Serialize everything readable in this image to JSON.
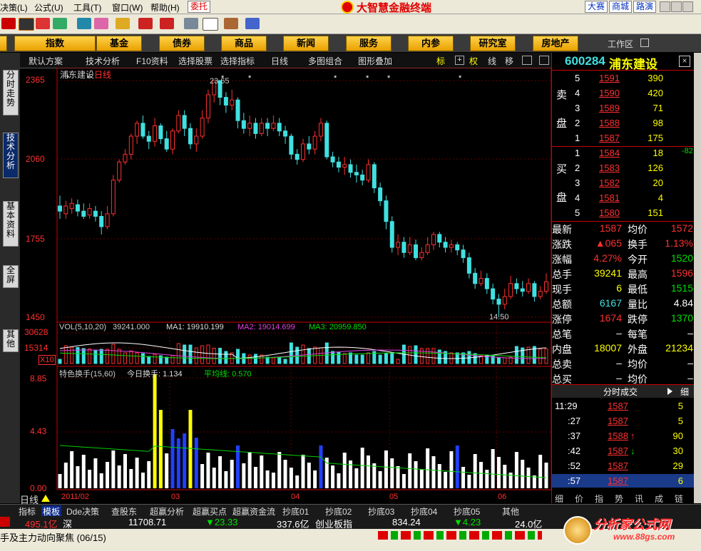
{
  "menu": {
    "items": [
      "决策(L)",
      "公式(U)",
      "工具(T)",
      "窗口(W)",
      "帮助(H)"
    ],
    "trade_tag": "委托",
    "brand": "大智慧金融终端",
    "right_tags": [
      "大赛",
      "商城",
      "路演"
    ]
  },
  "nav": {
    "buttons": [
      "指数",
      "基金",
      "债券",
      "商品",
      "新闻",
      "服务",
      "内参",
      "研究室",
      "房地产"
    ],
    "workspace": "工作区"
  },
  "left_tabs": [
    "分时走势",
    "技术分析",
    "基本资料",
    "全屏",
    "其他"
  ],
  "chart_toolbar": {
    "items": [
      "默认方案",
      "技术分析",
      "F10资料",
      "选择股票",
      "选择指标",
      "日线",
      "多图组合",
      "图形叠加"
    ],
    "right_items": [
      "标",
      "权",
      "线",
      "移"
    ]
  },
  "chart": {
    "stock_label": "浦东建设",
    "period_label": "日线",
    "y_ticks": [
      "2365",
      "2060",
      "1755",
      "1450"
    ],
    "high_mark": "23.65",
    "low_mark": "14.50",
    "vol_header": "VOL(5,10,20)",
    "vol_value": "39241.000",
    "ma1": "MA1: 19910.199",
    "ma2": "MA2: 19014.699",
    "ma3": "MA3: 20959.850",
    "vol_ticks": [
      "30628",
      "15314",
      "X10"
    ],
    "turn_header": "特色换手(15,60)",
    "turn_today": "今日换手: 1.134",
    "turn_avg": "平均线: 0.570",
    "turn_ticks": [
      "8.85",
      "4.43",
      "0.00"
    ],
    "x_labels": [
      "2011/02",
      "03",
      "04",
      "05",
      "06"
    ],
    "bottom_label": "日线"
  },
  "chart_data": {
    "type": "candlestick",
    "title": "浦东建设 日线",
    "ylim": [
      1450,
      2365
    ],
    "x_months": [
      "2011/02",
      "03",
      "04",
      "05",
      "06"
    ],
    "candles": [
      [
        1880,
        1860,
        1920,
        1830
      ],
      [
        1850,
        1880,
        1900,
        1830
      ],
      [
        1870,
        1890,
        1910,
        1850
      ],
      [
        1885,
        1860,
        1905,
        1840
      ],
      [
        1860,
        1840,
        1890,
        1830
      ],
      [
        1845,
        1870,
        1890,
        1830
      ],
      [
        1860,
        1840,
        1880,
        1820
      ],
      [
        1840,
        1800,
        1860,
        1770
      ],
      [
        1800,
        1850,
        1880,
        1790
      ],
      [
        1850,
        1980,
        2000,
        1840
      ],
      [
        1980,
        2050,
        2060,
        1970
      ],
      [
        2050,
        2080,
        2100,
        2040
      ],
      [
        2080,
        2150,
        2160,
        2060
      ],
      [
        2150,
        2200,
        2210,
        2120
      ],
      [
        2200,
        2150,
        2230,
        2140
      ],
      [
        2150,
        2130,
        2170,
        2100
      ],
      [
        2130,
        2190,
        2220,
        2110
      ],
      [
        2190,
        2140,
        2200,
        2120
      ],
      [
        2140,
        2100,
        2170,
        2090
      ],
      [
        2100,
        2170,
        2180,
        2080
      ],
      [
        2170,
        2230,
        2250,
        2160
      ],
      [
        2230,
        2180,
        2250,
        2150
      ],
      [
        2180,
        2120,
        2200,
        2100
      ],
      [
        2120,
        2150,
        2180,
        2090
      ],
      [
        2150,
        2220,
        2250,
        2140
      ],
      [
        2220,
        2310,
        2330,
        2200
      ],
      [
        2310,
        2365,
        2365,
        2280
      ],
      [
        2365,
        2300,
        2365,
        2270
      ],
      [
        2300,
        2270,
        2320,
        2240
      ],
      [
        2270,
        2290,
        2330,
        2250
      ],
      [
        2290,
        2210,
        2300,
        2180
      ],
      [
        2210,
        2180,
        2240,
        2160
      ],
      [
        2180,
        2200,
        2230,
        2150
      ],
      [
        2200,
        2160,
        2220,
        2140
      ],
      [
        2160,
        2200,
        2220,
        2150
      ],
      [
        2200,
        2180,
        2220,
        2150
      ],
      [
        2180,
        2200,
        2230,
        2170
      ],
      [
        2200,
        2170,
        2220,
        2150
      ],
      [
        2170,
        2150,
        2190,
        2120
      ],
      [
        2150,
        2080,
        2160,
        2060
      ],
      [
        2080,
        2060,
        2100,
        2040
      ],
      [
        2060,
        2120,
        2140,
        2050
      ],
      [
        2120,
        2100,
        2150,
        2080
      ],
      [
        2100,
        2150,
        2170,
        2080
      ],
      [
        2150,
        2200,
        2220,
        2130
      ],
      [
        2200,
        2070,
        2210,
        2060
      ],
      [
        2070,
        2050,
        2090,
        2030
      ],
      [
        2050,
        2030,
        2070,
        2010
      ],
      [
        2030,
        2040,
        2070,
        2000
      ],
      [
        2040,
        2010,
        2060,
        1990
      ],
      [
        2010,
        2000,
        2040,
        1970
      ],
      [
        2000,
        1980,
        2020,
        1960
      ],
      [
        1980,
        2040,
        2060,
        1970
      ],
      [
        2040,
        1950,
        2050,
        1930
      ],
      [
        1950,
        1900,
        1970,
        1880
      ],
      [
        1900,
        1820,
        1920,
        1790
      ],
      [
        1820,
        1720,
        1840,
        1700
      ],
      [
        1720,
        1740,
        1770,
        1690
      ],
      [
        1740,
        1700,
        1760,
        1680
      ],
      [
        1700,
        1730,
        1760,
        1690
      ],
      [
        1730,
        1680,
        1750,
        1670
      ],
      [
        1680,
        1700,
        1720,
        1670
      ],
      [
        1700,
        1730,
        1760,
        1690
      ],
      [
        1730,
        1770,
        1780,
        1710
      ],
      [
        1770,
        1740,
        1780,
        1720
      ],
      [
        1740,
        1720,
        1760,
        1700
      ],
      [
        1720,
        1730,
        1750,
        1700
      ],
      [
        1730,
        1710,
        1740,
        1690
      ],
      [
        1710,
        1680,
        1730,
        1660
      ],
      [
        1680,
        1620,
        1700,
        1600
      ],
      [
        1620,
        1580,
        1640,
        1560
      ],
      [
        1580,
        1600,
        1630,
        1570
      ],
      [
        1600,
        1560,
        1620,
        1540
      ],
      [
        1560,
        1520,
        1580,
        1500
      ],
      [
        1520,
        1500,
        1540,
        1450
      ],
      [
        1500,
        1530,
        1560,
        1480
      ],
      [
        1530,
        1580,
        1610,
        1520
      ],
      [
        1580,
        1560,
        1600,
        1540
      ],
      [
        1560,
        1550,
        1590,
        1530
      ],
      [
        1550,
        1580,
        1600,
        1540
      ],
      [
        1580,
        1530,
        1590,
        1510
      ],
      [
        1530,
        1550,
        1570,
        1520
      ],
      [
        1550,
        1587,
        1620,
        1540
      ]
    ],
    "volume_ma": {
      "MA1": 19910.199,
      "MA2": 19014.699,
      "MA3": 20959.85
    },
    "turnover_today": 1.134,
    "turnover_avg": 0.57
  },
  "quote": {
    "code": "600284",
    "name": "浦东建设",
    "sell_label": [
      "卖",
      "盘"
    ],
    "buy_label": [
      "买",
      "盘"
    ],
    "asks": [
      {
        "lvl": "5",
        "price": "1591",
        "vol": "390"
      },
      {
        "lvl": "4",
        "price": "1590",
        "vol": "420"
      },
      {
        "lvl": "3",
        "price": "1589",
        "vol": "71"
      },
      {
        "lvl": "2",
        "price": "1588",
        "vol": "98"
      },
      {
        "lvl": "1",
        "price": "1587",
        "vol": "175"
      }
    ],
    "bids": [
      {
        "lvl": "1",
        "price": "1584",
        "vol": "18"
      },
      {
        "lvl": "2",
        "price": "1583",
        "vol": "126"
      },
      {
        "lvl": "3",
        "price": "1582",
        "vol": "20"
      },
      {
        "lvl": "4",
        "price": "1581",
        "vol": "4"
      },
      {
        "lvl": "5",
        "price": "1580",
        "vol": "151"
      }
    ],
    "bid_change": "-82",
    "stats": [
      [
        "最新",
        "1587",
        "均价",
        "1572"
      ],
      [
        "涨跌",
        "▲065",
        "换手",
        "1.13%"
      ],
      [
        "涨幅",
        "4.27%",
        "今开",
        "1520"
      ],
      [
        "总手",
        "39241",
        "最高",
        "1596"
      ],
      [
        "现手",
        "6",
        "最低",
        "1515"
      ],
      [
        "总额",
        "6167",
        "量比",
        "4.84"
      ],
      [
        "涨停",
        "1674",
        "跌停",
        "1370"
      ],
      [
        "总笔",
        "–",
        "每笔",
        "–"
      ],
      [
        "内盘",
        "18007",
        "外盘",
        "21234"
      ],
      [
        "总卖",
        "–",
        "均价",
        "–"
      ],
      [
        "总买",
        "–",
        "均价",
        "–"
      ]
    ],
    "ticks_header": "分时成交",
    "ticks_right": "细",
    "ticks": [
      {
        "time": "11:29",
        "price": "1587",
        "vol": "5",
        "arrow": ""
      },
      {
        "time": ":27",
        "price": "1587",
        "vol": "5",
        "arrow": ""
      },
      {
        "time": ":37",
        "price": "1588",
        "vol": "90",
        "arrow": "↑"
      },
      {
        "time": ":42",
        "price": "1587",
        "vol": "30",
        "arrow": "↓"
      },
      {
        "time": ":52",
        "price": "1587",
        "vol": "29",
        "arrow": ""
      },
      {
        "time": ":57",
        "price": "1587",
        "vol": "6",
        "arrow": ""
      }
    ],
    "bottom_tabs": [
      "细",
      "价",
      "指",
      "势",
      "讯",
      "成",
      "链"
    ]
  },
  "bottom_tabs": [
    "指标",
    "模板",
    "Dde决策",
    "查股东",
    "超赢分析",
    "超赢买点",
    "超赢资金流",
    "抄底01",
    "抄底02",
    "抄底03",
    "抄底04",
    "抄底05",
    "其他"
  ],
  "status_bar": {
    "a": "495.1亿",
    "a_label": "深",
    "b": "11708.71",
    "c": "▼23.33",
    "d": "337.6亿",
    "d_label": "创业板指",
    "e": "834.24",
    "f": "▼4.23",
    "g": "24.0亿"
  },
  "news_ticker": "手及主力动向聚焦 (06/15)",
  "watermark": {
    "text": "分析家公式网",
    "url": "www.88gs.com"
  }
}
